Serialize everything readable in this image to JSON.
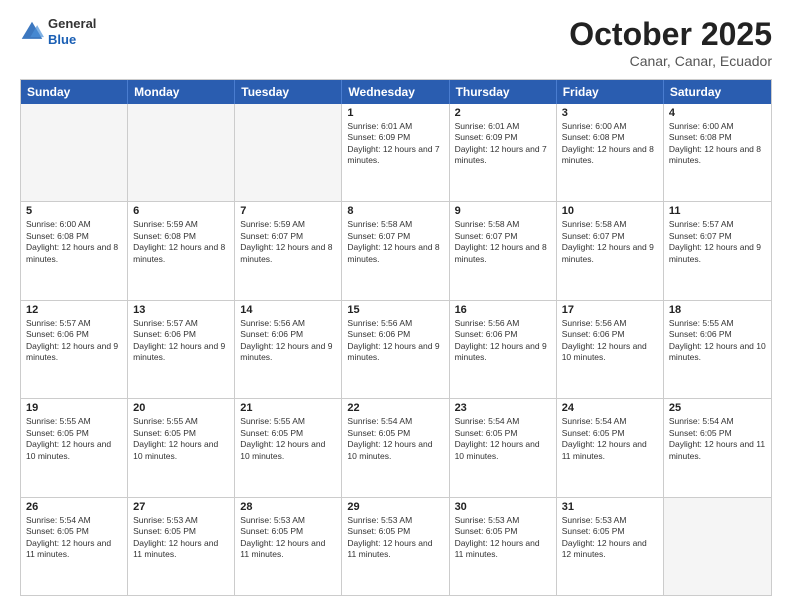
{
  "logo": {
    "general": "General",
    "blue": "Blue"
  },
  "title": "October 2025",
  "subtitle": "Canar, Canar, Ecuador",
  "header_days": [
    "Sunday",
    "Monday",
    "Tuesday",
    "Wednesday",
    "Thursday",
    "Friday",
    "Saturday"
  ],
  "weeks": [
    [
      {
        "day": "",
        "info": ""
      },
      {
        "day": "",
        "info": ""
      },
      {
        "day": "",
        "info": ""
      },
      {
        "day": "1",
        "info": "Sunrise: 6:01 AM\nSunset: 6:09 PM\nDaylight: 12 hours and 7 minutes."
      },
      {
        "day": "2",
        "info": "Sunrise: 6:01 AM\nSunset: 6:09 PM\nDaylight: 12 hours and 7 minutes."
      },
      {
        "day": "3",
        "info": "Sunrise: 6:00 AM\nSunset: 6:08 PM\nDaylight: 12 hours and 8 minutes."
      },
      {
        "day": "4",
        "info": "Sunrise: 6:00 AM\nSunset: 6:08 PM\nDaylight: 12 hours and 8 minutes."
      }
    ],
    [
      {
        "day": "5",
        "info": "Sunrise: 6:00 AM\nSunset: 6:08 PM\nDaylight: 12 hours and 8 minutes."
      },
      {
        "day": "6",
        "info": "Sunrise: 5:59 AM\nSunset: 6:08 PM\nDaylight: 12 hours and 8 minutes."
      },
      {
        "day": "7",
        "info": "Sunrise: 5:59 AM\nSunset: 6:07 PM\nDaylight: 12 hours and 8 minutes."
      },
      {
        "day": "8",
        "info": "Sunrise: 5:58 AM\nSunset: 6:07 PM\nDaylight: 12 hours and 8 minutes."
      },
      {
        "day": "9",
        "info": "Sunrise: 5:58 AM\nSunset: 6:07 PM\nDaylight: 12 hours and 8 minutes."
      },
      {
        "day": "10",
        "info": "Sunrise: 5:58 AM\nSunset: 6:07 PM\nDaylight: 12 hours and 9 minutes."
      },
      {
        "day": "11",
        "info": "Sunrise: 5:57 AM\nSunset: 6:07 PM\nDaylight: 12 hours and 9 minutes."
      }
    ],
    [
      {
        "day": "12",
        "info": "Sunrise: 5:57 AM\nSunset: 6:06 PM\nDaylight: 12 hours and 9 minutes."
      },
      {
        "day": "13",
        "info": "Sunrise: 5:57 AM\nSunset: 6:06 PM\nDaylight: 12 hours and 9 minutes."
      },
      {
        "day": "14",
        "info": "Sunrise: 5:56 AM\nSunset: 6:06 PM\nDaylight: 12 hours and 9 minutes."
      },
      {
        "day": "15",
        "info": "Sunrise: 5:56 AM\nSunset: 6:06 PM\nDaylight: 12 hours and 9 minutes."
      },
      {
        "day": "16",
        "info": "Sunrise: 5:56 AM\nSunset: 6:06 PM\nDaylight: 12 hours and 9 minutes."
      },
      {
        "day": "17",
        "info": "Sunrise: 5:56 AM\nSunset: 6:06 PM\nDaylight: 12 hours and 10 minutes."
      },
      {
        "day": "18",
        "info": "Sunrise: 5:55 AM\nSunset: 6:06 PM\nDaylight: 12 hours and 10 minutes."
      }
    ],
    [
      {
        "day": "19",
        "info": "Sunrise: 5:55 AM\nSunset: 6:05 PM\nDaylight: 12 hours and 10 minutes."
      },
      {
        "day": "20",
        "info": "Sunrise: 5:55 AM\nSunset: 6:05 PM\nDaylight: 12 hours and 10 minutes."
      },
      {
        "day": "21",
        "info": "Sunrise: 5:55 AM\nSunset: 6:05 PM\nDaylight: 12 hours and 10 minutes."
      },
      {
        "day": "22",
        "info": "Sunrise: 5:54 AM\nSunset: 6:05 PM\nDaylight: 12 hours and 10 minutes."
      },
      {
        "day": "23",
        "info": "Sunrise: 5:54 AM\nSunset: 6:05 PM\nDaylight: 12 hours and 10 minutes."
      },
      {
        "day": "24",
        "info": "Sunrise: 5:54 AM\nSunset: 6:05 PM\nDaylight: 12 hours and 11 minutes."
      },
      {
        "day": "25",
        "info": "Sunrise: 5:54 AM\nSunset: 6:05 PM\nDaylight: 12 hours and 11 minutes."
      }
    ],
    [
      {
        "day": "26",
        "info": "Sunrise: 5:54 AM\nSunset: 6:05 PM\nDaylight: 12 hours and 11 minutes."
      },
      {
        "day": "27",
        "info": "Sunrise: 5:53 AM\nSunset: 6:05 PM\nDaylight: 12 hours and 11 minutes."
      },
      {
        "day": "28",
        "info": "Sunrise: 5:53 AM\nSunset: 6:05 PM\nDaylight: 12 hours and 11 minutes."
      },
      {
        "day": "29",
        "info": "Sunrise: 5:53 AM\nSunset: 6:05 PM\nDaylight: 12 hours and 11 minutes."
      },
      {
        "day": "30",
        "info": "Sunrise: 5:53 AM\nSunset: 6:05 PM\nDaylight: 12 hours and 11 minutes."
      },
      {
        "day": "31",
        "info": "Sunrise: 5:53 AM\nSunset: 6:05 PM\nDaylight: 12 hours and 12 minutes."
      },
      {
        "day": "",
        "info": ""
      }
    ]
  ]
}
